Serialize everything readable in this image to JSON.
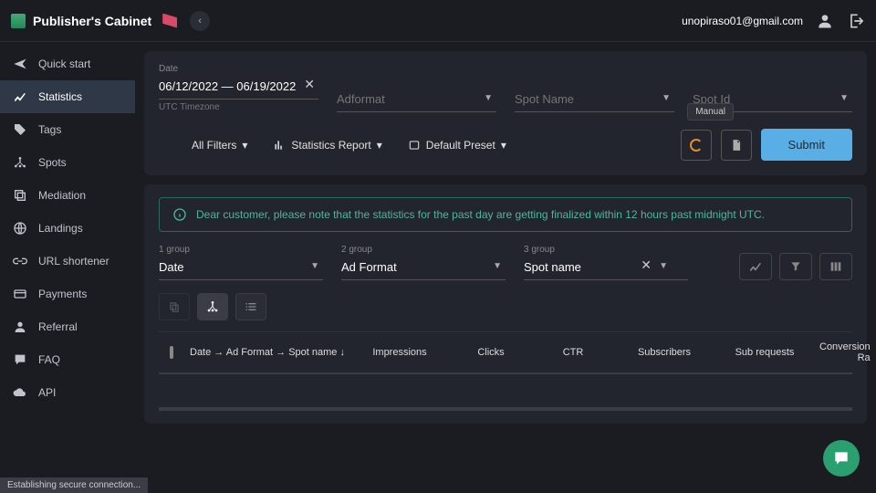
{
  "brand": "Publisher's Cabinet",
  "user_email": "unopiraso01@gmail.com",
  "sidebar": {
    "items": [
      {
        "label": "Quick start"
      },
      {
        "label": "Statistics"
      },
      {
        "label": "Tags"
      },
      {
        "label": "Spots"
      },
      {
        "label": "Mediation"
      },
      {
        "label": "Landings"
      },
      {
        "label": "URL shortener"
      },
      {
        "label": "Payments"
      },
      {
        "label": "Referral"
      },
      {
        "label": "FAQ"
      },
      {
        "label": "API"
      }
    ]
  },
  "filters": {
    "date_label": "Date",
    "date_value": "06/12/2022 — 06/19/2022",
    "date_hint": "UTC Timezone",
    "adformat_placeholder": "Adformat",
    "spotname_placeholder": "Spot Name",
    "spotid_placeholder": "Spot Id"
  },
  "controls": {
    "all_filters": "All Filters",
    "stats_report": "Statistics Report",
    "default_preset": "Default Preset",
    "manual": "Manual",
    "submit": "Submit"
  },
  "notice": "Dear customer, please note that the statistics for the past day are getting finalized within 12 hours past midnight UTC.",
  "groups": {
    "g1_label": "1 group",
    "g1_value": "Date",
    "g2_label": "2 group",
    "g2_value": "Ad Format",
    "g3_label": "3 group",
    "g3_value": "Spot name"
  },
  "table": {
    "h1": "Date → Ad Format → Spot name ↓",
    "h2": "Impressions",
    "h3": "Clicks",
    "h4": "CTR",
    "h5": "Subscribers",
    "h6": "Sub requests",
    "h7": "Conversion Ra"
  },
  "status": "Establishing secure connection..."
}
